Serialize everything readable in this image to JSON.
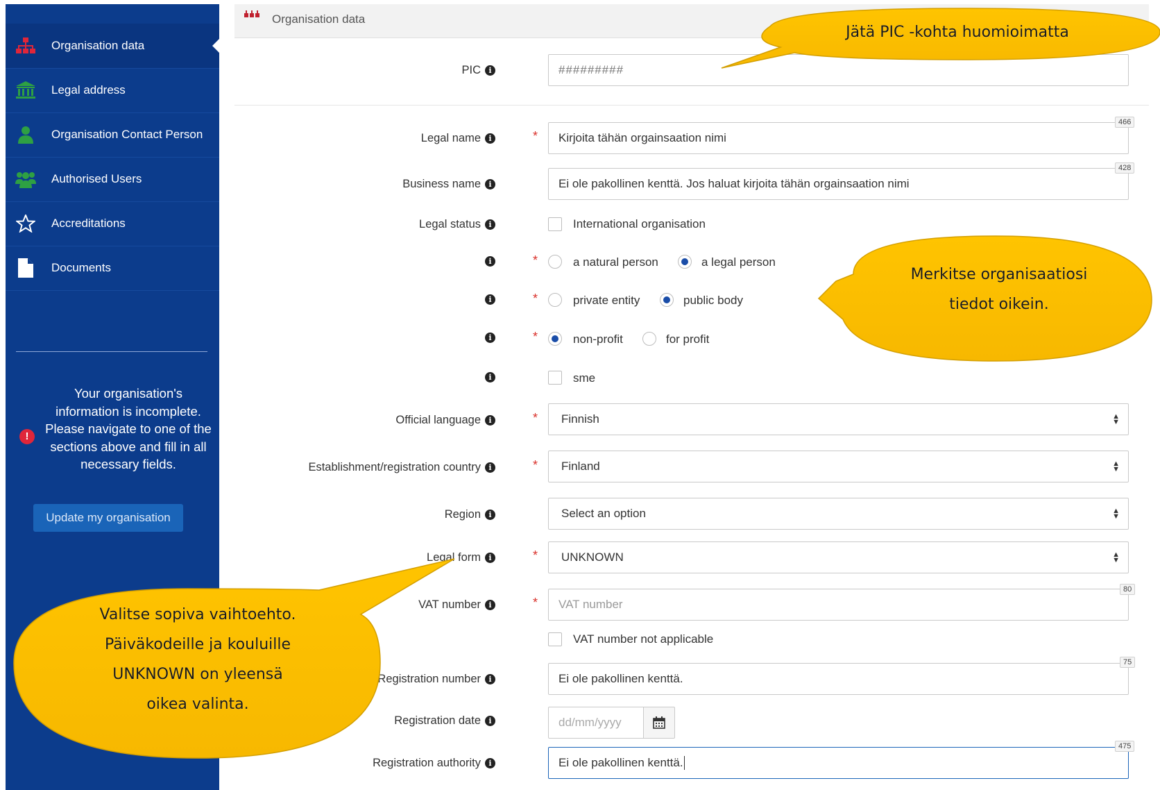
{
  "sidebar": {
    "items": [
      {
        "label": "Organisation data",
        "icon": "sitemap-icon",
        "active": true
      },
      {
        "label": "Legal address",
        "icon": "bank-icon"
      },
      {
        "label": "Organisation Contact Person",
        "icon": "user-icon"
      },
      {
        "label": "Authorised Users",
        "icon": "users-icon"
      },
      {
        "label": "Accreditations",
        "icon": "star-icon"
      },
      {
        "label": "Documents",
        "icon": "document-icon"
      }
    ],
    "warning": "Your organisation's information is incomplete. Please navigate to one of the sections above and fill in all necessary fields.",
    "update_button": "Update my organisation"
  },
  "header": {
    "title": "Organisation data"
  },
  "form": {
    "pic": {
      "label": "PIC",
      "value": "#########"
    },
    "legal_name": {
      "label": "Legal name",
      "value": "Kirjoita tähän orgainsaation nimi",
      "counter": "466"
    },
    "business_name": {
      "label": "Business name",
      "value": "Ei ole pakollinen kenttä. Jos haluat kirjoita tähän orgainsaation nimi",
      "counter": "428"
    },
    "legal_status": {
      "label": "Legal status",
      "option": "International organisation"
    },
    "person_type": {
      "options": [
        "a natural person",
        "a legal person"
      ],
      "selected": "a legal person"
    },
    "entity_type": {
      "options": [
        "private entity",
        "public body"
      ],
      "selected": "public body"
    },
    "profit_type": {
      "options": [
        "non-profit",
        "for profit"
      ],
      "selected": "non-profit"
    },
    "sme": {
      "option": "sme"
    },
    "official_language": {
      "label": "Official language",
      "value": "Finnish"
    },
    "country": {
      "label": "Establishment/registration country",
      "value": "Finland"
    },
    "region": {
      "label": "Region",
      "value": "Select an option"
    },
    "legal_form": {
      "label": "Legal form",
      "value": "UNKNOWN"
    },
    "vat": {
      "label": "VAT number",
      "placeholder": "VAT number",
      "counter": "80",
      "not_applicable": "VAT number not applicable"
    },
    "registration_number": {
      "label": "Registration number",
      "value": "Ei ole pakollinen kenttä.",
      "counter": "75"
    },
    "registration_date": {
      "label": "Registration date",
      "placeholder": "dd/mm/yyyy"
    },
    "registration_authority": {
      "label": "Registration authority",
      "value": "Ei ole pakollinen kenttä.",
      "counter": "475"
    }
  },
  "callouts": {
    "pic_note": "Jätä PIC -kohta huomioimatta",
    "org_note_line1": "Merkitse organisaatiosi",
    "org_note_line2": "tiedot oikein.",
    "legal_form_note_line1": "Valitse sopiva vaihtoehto.",
    "legal_form_note_line2": "Päiväkodeille ja kouluille",
    "legal_form_note_line3": "UNKNOWN on yleensä",
    "legal_form_note_line4": "oikea valinta."
  },
  "colors": {
    "sidebar": "#0c3c8c",
    "callout": "#fcbf00",
    "accent": "#1a4da8",
    "required": "#d9302a"
  }
}
